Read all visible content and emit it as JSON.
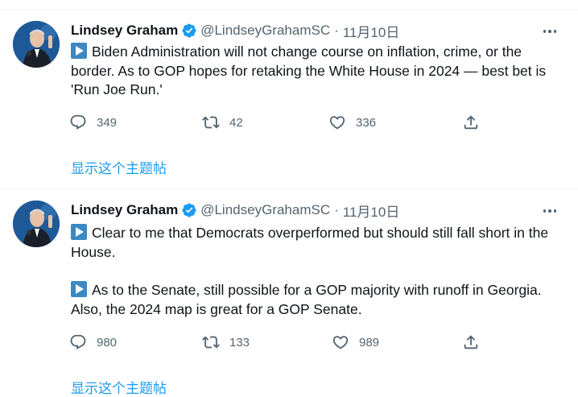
{
  "tweets": [
    {
      "author_name": "Lindsey Graham",
      "handle": "@LindseyGrahamSC",
      "separator": "·",
      "date": "11月10日",
      "paragraphs": [
        "Biden Administration will not change course on inflation, crime, or the border.  As to GOP hopes for retaking the White House in 2024 — best bet is 'Run Joe Run.'"
      ],
      "replies": "349",
      "retweets": "42",
      "likes": "336",
      "show_thread": "显示这个主题帖"
    },
    {
      "author_name": "Lindsey Graham",
      "handle": "@LindseyGrahamSC",
      "separator": "·",
      "date": "11月10日",
      "paragraphs": [
        "Clear to me that Democrats overperformed but should still fall short in the House.",
        "As to the Senate, still possible for a GOP majority with runoff in Georgia.  Also, the 2024 map is great for a GOP Senate."
      ],
      "replies": "980",
      "retweets": "133",
      "likes": "989",
      "show_thread": "显示这个主题帖"
    }
  ],
  "colors": {
    "link": "#1d9bf0",
    "verified": "#1d9bf0",
    "muted": "#536471"
  },
  "icons": [
    "verified-badge-icon",
    "more-icon",
    "play-button-emoji-icon",
    "reply-icon",
    "retweet-icon",
    "like-icon",
    "share-icon"
  ]
}
